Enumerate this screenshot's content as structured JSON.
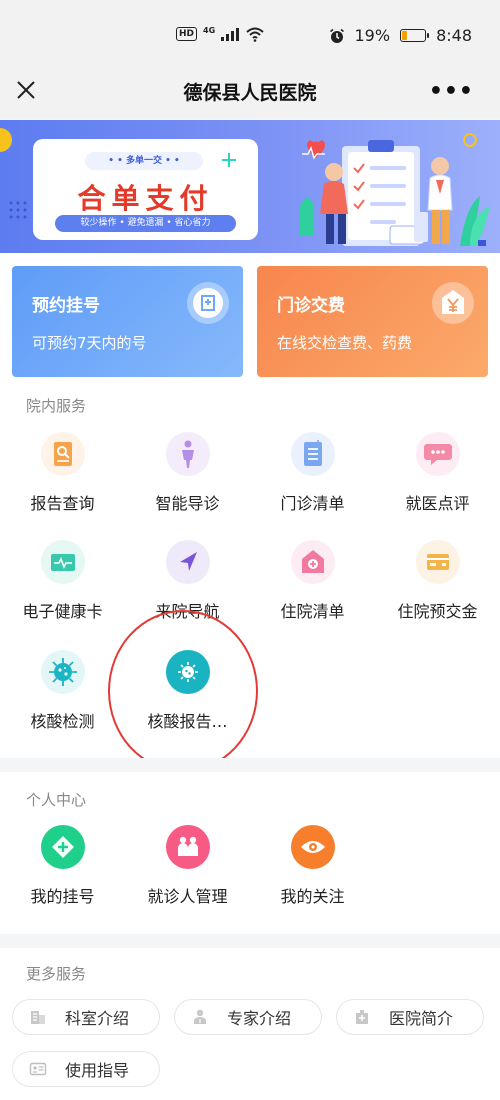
{
  "status_bar": {
    "network": "4G",
    "hd_label": "HD",
    "battery": "19%",
    "time": "8:48"
  },
  "nav": {
    "title": "德保县人民医院"
  },
  "banner": {
    "tag": "• • 多单一交 • •",
    "title": "合单支付",
    "subtitle": "较少操作 • 避免遗漏 • 省心省力"
  },
  "main_cards": [
    {
      "title": "预约挂号",
      "subtitle": "可预约7天内的号",
      "icon": "hospital-building-icon",
      "color": "#6ea8f9"
    },
    {
      "title": "门诊交费",
      "subtitle": "在线交检查费、药费",
      "icon": "yuan-payment-icon",
      "color": "#f8955a"
    }
  ],
  "in_hospital": {
    "title": "院内服务",
    "items": [
      {
        "label": "报告查询",
        "icon": "report-icon"
      },
      {
        "label": "智能导诊",
        "icon": "body-figure-icon"
      },
      {
        "label": "门诊清单",
        "icon": "list-document-icon"
      },
      {
        "label": "就医点评",
        "icon": "comment-bubble-icon"
      },
      {
        "label": "电子健康卡",
        "icon": "health-card-icon"
      },
      {
        "label": "来院导航",
        "icon": "navigation-arrow-icon"
      },
      {
        "label": "住院清单",
        "icon": "hospital-house-icon"
      },
      {
        "label": "住院预交金",
        "icon": "deposit-card-icon"
      },
      {
        "label": "核酸检测",
        "icon": "virus-icon"
      },
      {
        "label": "核酸报告…",
        "icon": "virus-report-icon"
      }
    ]
  },
  "personal": {
    "title": "个人中心",
    "items": [
      {
        "label": "我的挂号",
        "icon": "plus-register-icon",
        "color": "#1fcf8c"
      },
      {
        "label": "就诊人管理",
        "icon": "people-icon",
        "color": "#f75a84"
      },
      {
        "label": "我的关注",
        "icon": "eye-icon",
        "color": "#f77e2a"
      }
    ]
  },
  "more": {
    "title": "更多服务",
    "items": [
      {
        "label": "科室介绍",
        "icon": "building-icon"
      },
      {
        "label": "专家介绍",
        "icon": "doctor-icon"
      },
      {
        "label": "医院简介",
        "icon": "hospital-icon"
      },
      {
        "label": "使用指导",
        "icon": "guide-card-icon"
      }
    ]
  }
}
